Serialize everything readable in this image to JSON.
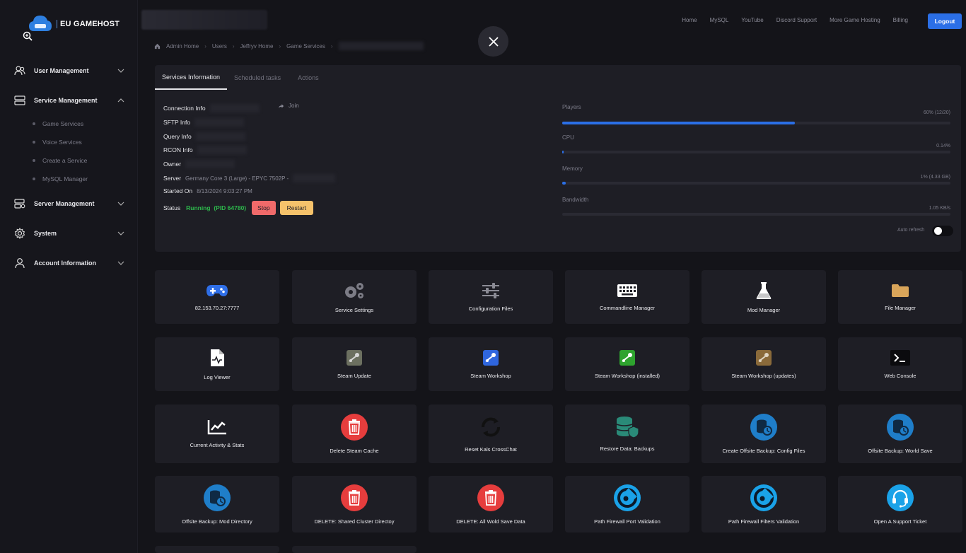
{
  "brand": {
    "name": "EU GAMEHOST",
    "accent": "#2b6fe6"
  },
  "sidebar": {
    "items": [
      {
        "label": "User Management",
        "icon": "users-icon",
        "expanded": false
      },
      {
        "label": "Service Management",
        "icon": "server-icon",
        "expanded": true,
        "children": [
          "Game Services",
          "Voice Services",
          "Create a Service",
          "MySQL Manager"
        ]
      },
      {
        "label": "Server Management",
        "icon": "server-settings-icon",
        "expanded": false
      },
      {
        "label": "System",
        "icon": "gear-icon",
        "expanded": false
      },
      {
        "label": "Account Information",
        "icon": "user-icon",
        "expanded": false
      }
    ]
  },
  "topnav": {
    "links": [
      "Home",
      "MySQL",
      "YouTube",
      "Discord Support",
      "More Game Hosting",
      "Billing"
    ],
    "logout_label": "Logout"
  },
  "breadcrumb": [
    "Admin Home",
    "Users",
    "Jeffryv Home",
    "Game Services"
  ],
  "tabs": [
    "Services Information",
    "Scheduled tasks",
    "Actions"
  ],
  "info": {
    "connection_label": "Connection Info",
    "join_label": "Join",
    "sftp_label": "SFTP Info",
    "query_label": "Query Info",
    "rcon_label": "RCON Info",
    "owner_label": "Owner",
    "server_label": "Server",
    "server_value": "Germany Core 3 (Large) - EPYC 7502P -",
    "started_label": "Started On",
    "started_value": "8/13/2024 9:03:27 PM",
    "status_label": "Status",
    "status_value": "Running",
    "status_pid": "(PID 64780)",
    "stop_label": "Stop",
    "restart_label": "Restart",
    "status_color": "#2db84c"
  },
  "metrics": [
    {
      "label": "Players",
      "value": "60% (12/20)",
      "fraction": 0.6
    },
    {
      "label": "CPU",
      "value": "0.14%",
      "fraction": 0.0014
    },
    {
      "label": "Memory",
      "value": "1% (4.33 GB)",
      "fraction": 0.01
    },
    {
      "label": "Bandwidth",
      "value": "1.05 KB/s",
      "fraction": 0
    }
  ],
  "auto_refresh_label": "Auto refresh",
  "tiles": [
    {
      "label": "82.153.70.27:7777",
      "icon": "gamepad-icon"
    },
    {
      "label": "Service Settings",
      "icon": "gears-icon"
    },
    {
      "label": "Configuration Files",
      "icon": "sliders-icon"
    },
    {
      "label": "Commandline Manager",
      "icon": "keyboard-icon"
    },
    {
      "label": "Mod Manager",
      "icon": "flask-icon"
    },
    {
      "label": "File Manager",
      "icon": "folder-icon"
    },
    {
      "label": "Log Viewer",
      "icon": "log-file-icon"
    },
    {
      "label": "Steam Update",
      "icon": "steam-update-icon"
    },
    {
      "label": "Steam Workshop",
      "icon": "steam-workshop-icon"
    },
    {
      "label": "Steam Workshop (installed)",
      "icon": "steam-workshop-installed-icon"
    },
    {
      "label": "Steam Workshop (updates)",
      "icon": "steam-workshop-updates-icon"
    },
    {
      "label": "Web Console",
      "icon": "terminal-icon"
    },
    {
      "label": "Current Activity & Stats",
      "icon": "chart-icon"
    },
    {
      "label": "Delete Steam Cache",
      "icon": "trash-icon"
    },
    {
      "label": "Reset Kals CrossChat",
      "icon": "sync-icon"
    },
    {
      "label": "Restore Data: Backups",
      "icon": "database-shield-icon"
    },
    {
      "label": "Create Offsite Backup: Config Files",
      "icon": "database-backup-icon"
    },
    {
      "label": "Offsite Backup: World Save",
      "icon": "database-backup-icon"
    },
    {
      "label": "Offsite Backup: Mod Directory",
      "icon": "database-backup-icon"
    },
    {
      "label": "DELETE: Shared Cluster Directoy",
      "icon": "trash-icon"
    },
    {
      "label": "DELETE: All Wold Save Data",
      "icon": "trash-icon"
    },
    {
      "label": "Path Firewall Port Validation",
      "icon": "firewall-icon"
    },
    {
      "label": "Path Firewall Filters Validation",
      "icon": "firewall-icon"
    },
    {
      "label": "Open A Support Ticket",
      "icon": "headset-icon"
    }
  ]
}
